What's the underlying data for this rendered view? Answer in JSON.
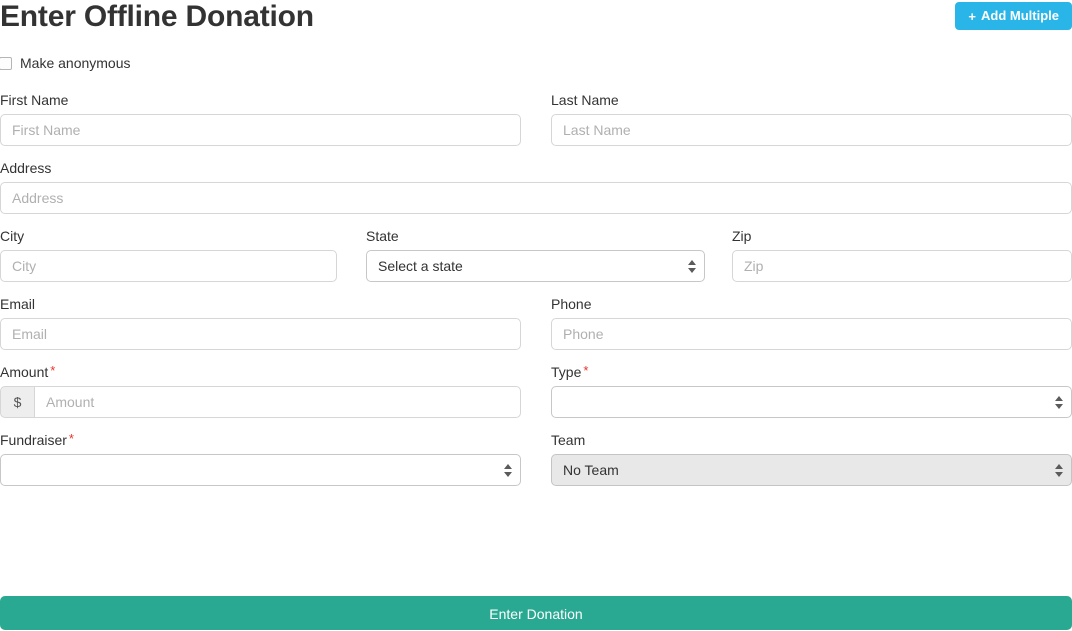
{
  "header": {
    "title": "Enter Offline Donation",
    "add_multiple_label": "Add Multiple",
    "plus_icon": "+",
    "accent_blue": "#29b5e8"
  },
  "anonymous": {
    "label": "Make anonymous",
    "checked": false
  },
  "form": {
    "first_name": {
      "label": "First Name",
      "placeholder": "First Name",
      "value": ""
    },
    "last_name": {
      "label": "Last Name",
      "placeholder": "Last Name",
      "value": ""
    },
    "address": {
      "label": "Address",
      "placeholder": "Address",
      "value": ""
    },
    "city": {
      "label": "City",
      "placeholder": "City",
      "value": ""
    },
    "state": {
      "label": "State",
      "selected": "Select a state"
    },
    "zip": {
      "label": "Zip",
      "placeholder": "Zip",
      "value": ""
    },
    "email": {
      "label": "Email",
      "placeholder": "Email",
      "value": ""
    },
    "phone": {
      "label": "Phone",
      "placeholder": "Phone",
      "value": ""
    },
    "amount": {
      "label": "Amount",
      "required_mark": "*",
      "currency_symbol": "$",
      "placeholder": "Amount",
      "value": ""
    },
    "type": {
      "label": "Type",
      "required_mark": "*",
      "selected": ""
    },
    "fundraiser": {
      "label": "Fundraiser",
      "required_mark": "*",
      "selected": ""
    },
    "team": {
      "label": "Team",
      "selected": "No Team"
    }
  },
  "submit": {
    "label": "Enter Donation",
    "color": "#29a892"
  }
}
